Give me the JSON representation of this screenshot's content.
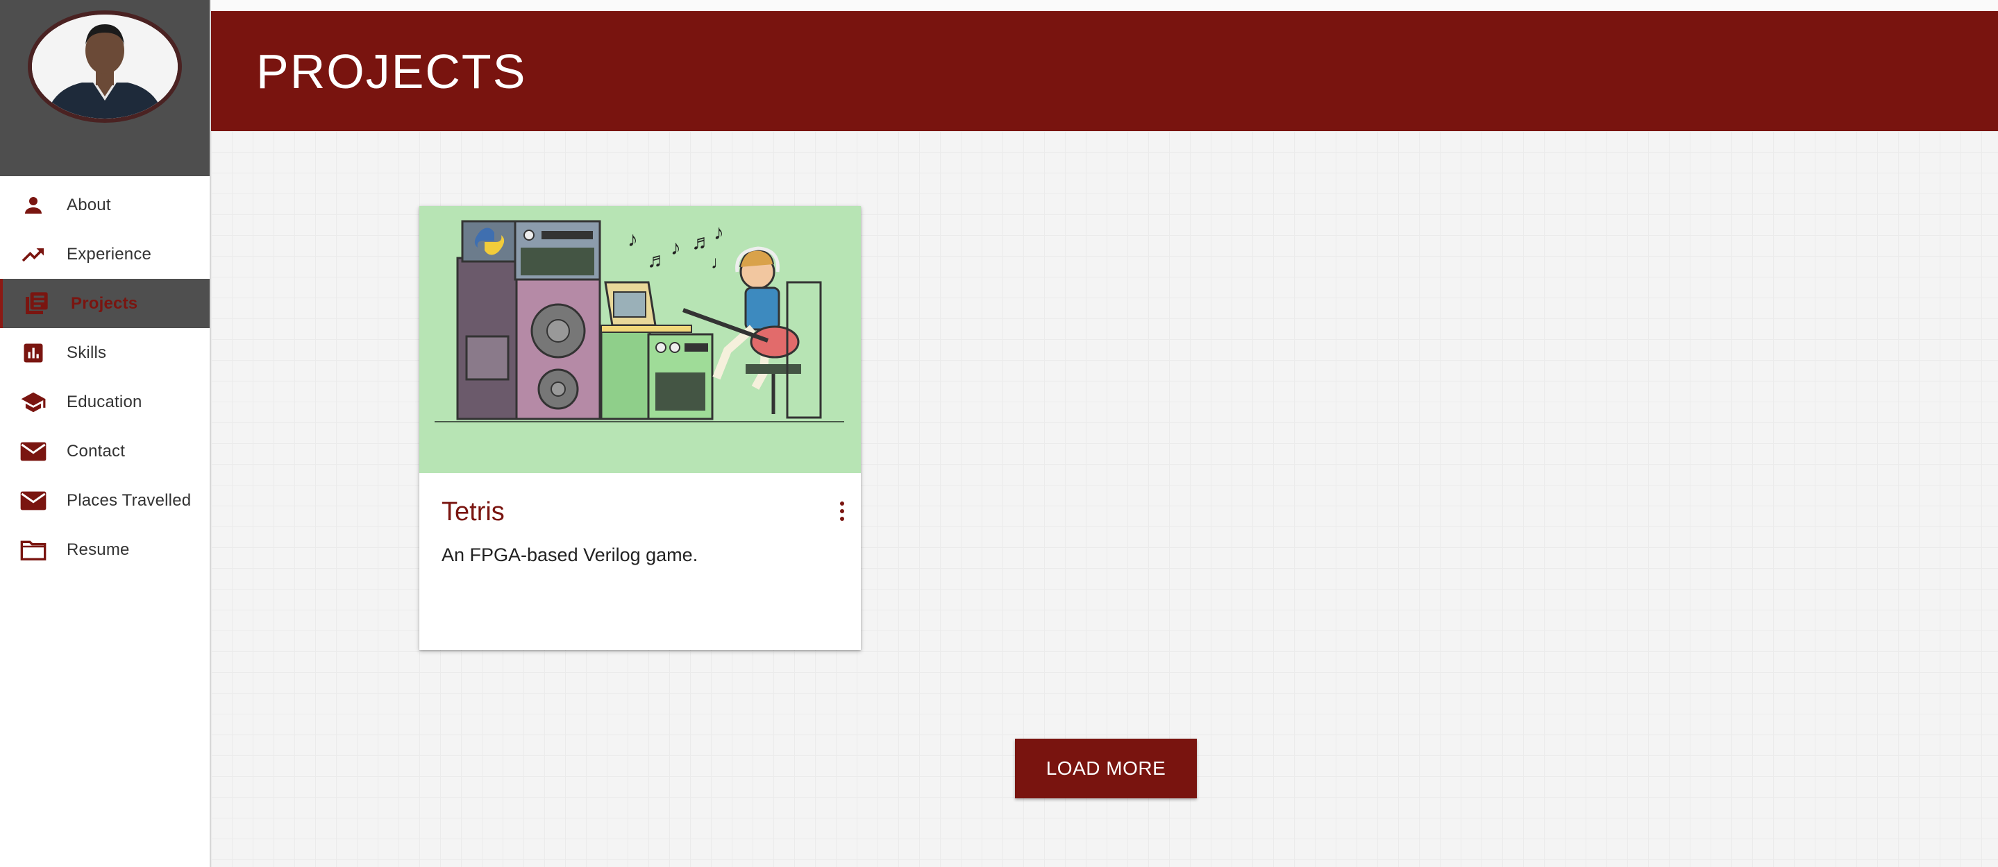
{
  "header": {
    "title": "PROJECTS"
  },
  "profile": {
    "avatar_icon": "person-photo"
  },
  "sidebar": {
    "items": [
      {
        "label": "About",
        "icon": "person-icon"
      },
      {
        "label": "Experience",
        "icon": "trending-up-icon"
      },
      {
        "label": "Projects",
        "icon": "library-books-icon",
        "active": true
      },
      {
        "label": "Skills",
        "icon": "bar-chart-icon"
      },
      {
        "label": "Education",
        "icon": "school-icon"
      },
      {
        "label": "Contact",
        "icon": "mail-icon"
      },
      {
        "label": "Places Travelled",
        "icon": "mail-icon"
      },
      {
        "label": "Resume",
        "icon": "folder-icon"
      }
    ]
  },
  "projects": [
    {
      "title": "Tetris",
      "description": "An FPGA-based Verilog game.",
      "image": "music-studio-illustration",
      "menu_icon": "more-vert-icon"
    }
  ],
  "load_more_label": "LOAD MORE",
  "colors": {
    "accent": "#79140f",
    "sidebar_profile_bg": "#4e4e4e",
    "card_image_bg": "#b7e4b4",
    "page_bg": "#f4f4f4"
  }
}
